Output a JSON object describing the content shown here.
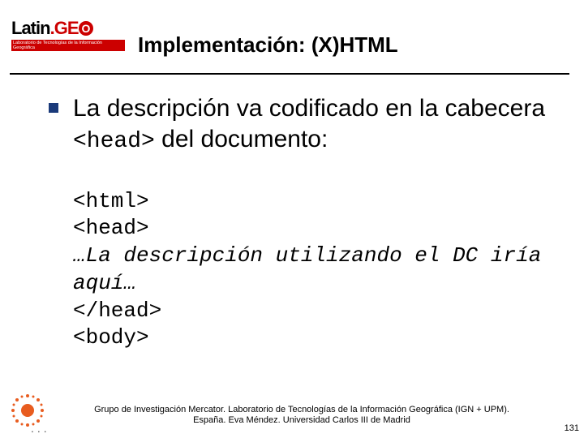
{
  "logo": {
    "brand_latin": "Latin",
    "brand_dot": ".",
    "brand_g": "G",
    "brand_e": "E",
    "brand_o": "O",
    "subtitle": "Laboratorio de Tecnologías de la Información Geográfica"
  },
  "title": "Implementación: (X)HTML",
  "bullet": {
    "text_before": "La descripción va codificado en la cabecera ",
    "mono": "<head>",
    "text_after": " del documento:"
  },
  "code": {
    "line1": "<html>",
    "line2": "<head>",
    "line3": "…La descripción utilizando el DC iría aquí…",
    "line4": "</head>",
    "line5": "<body>"
  },
  "footer": {
    "line1": "Grupo de Investigación Mercator. Laboratorio de Tecnologías de la Información Geográfica (IGN + UPM).",
    "line2": "España. Eva Méndez. Universidad Carlos III de Madrid"
  },
  "page_number": "131",
  "ellipsis": "..."
}
